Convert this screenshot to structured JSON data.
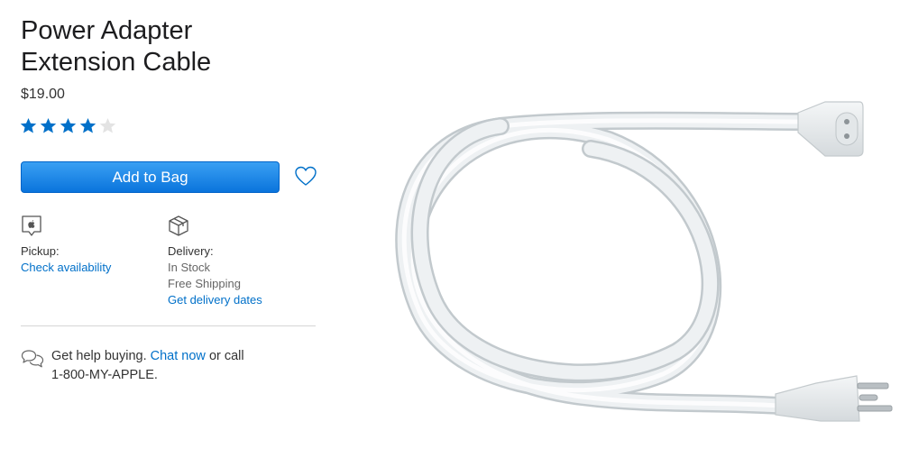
{
  "product": {
    "title_line1": "Power Adapter",
    "title_line2": "Extension Cable",
    "price": "$19.00",
    "rating": 4,
    "rating_max": 5,
    "star_color": "#0070c9"
  },
  "actions": {
    "add_to_bag_label": "Add to Bag",
    "button_color": "#0a74dc",
    "favorite_icon": "heart-icon"
  },
  "pickup": {
    "icon": "apple-store-icon",
    "label": "Pickup:",
    "link": "Check availability"
  },
  "delivery": {
    "icon": "box-icon",
    "label": "Delivery:",
    "stock": "In Stock",
    "shipping": "Free Shipping",
    "link": "Get delivery dates"
  },
  "help": {
    "icon": "chat-bubbles-icon",
    "prefix": "Get help buying.",
    "chat_link": "Chat now",
    "middle": "or call",
    "phone": "1-800-MY-APPLE."
  },
  "image": {
    "alt": "product-image-extension-cable"
  }
}
